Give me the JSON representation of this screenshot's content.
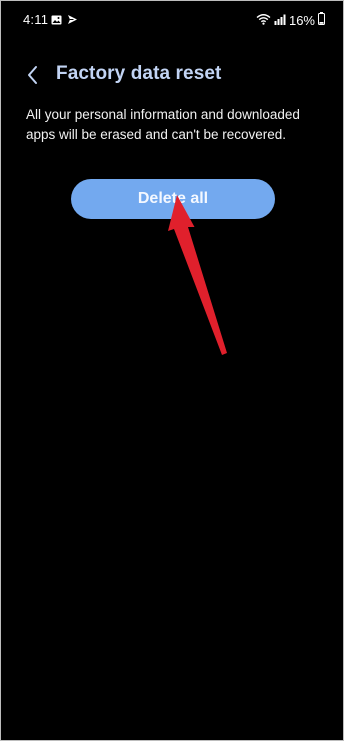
{
  "status_bar": {
    "time": "4:11",
    "battery": "16%",
    "icons": [
      "image-icon",
      "send-icon",
      "wifi-icon",
      "signal-icon",
      "battery-icon"
    ]
  },
  "header": {
    "title": "Factory data reset",
    "back_icon": "chevron-left-icon"
  },
  "main": {
    "description": "All your personal information and downloaded apps will be erased and can't be recovered.",
    "delete_label": "Delete all"
  },
  "colors": {
    "background": "#000000",
    "title": "#c2d4f4",
    "button": "#73a9ef",
    "annotation_arrow": "#e0202c"
  }
}
